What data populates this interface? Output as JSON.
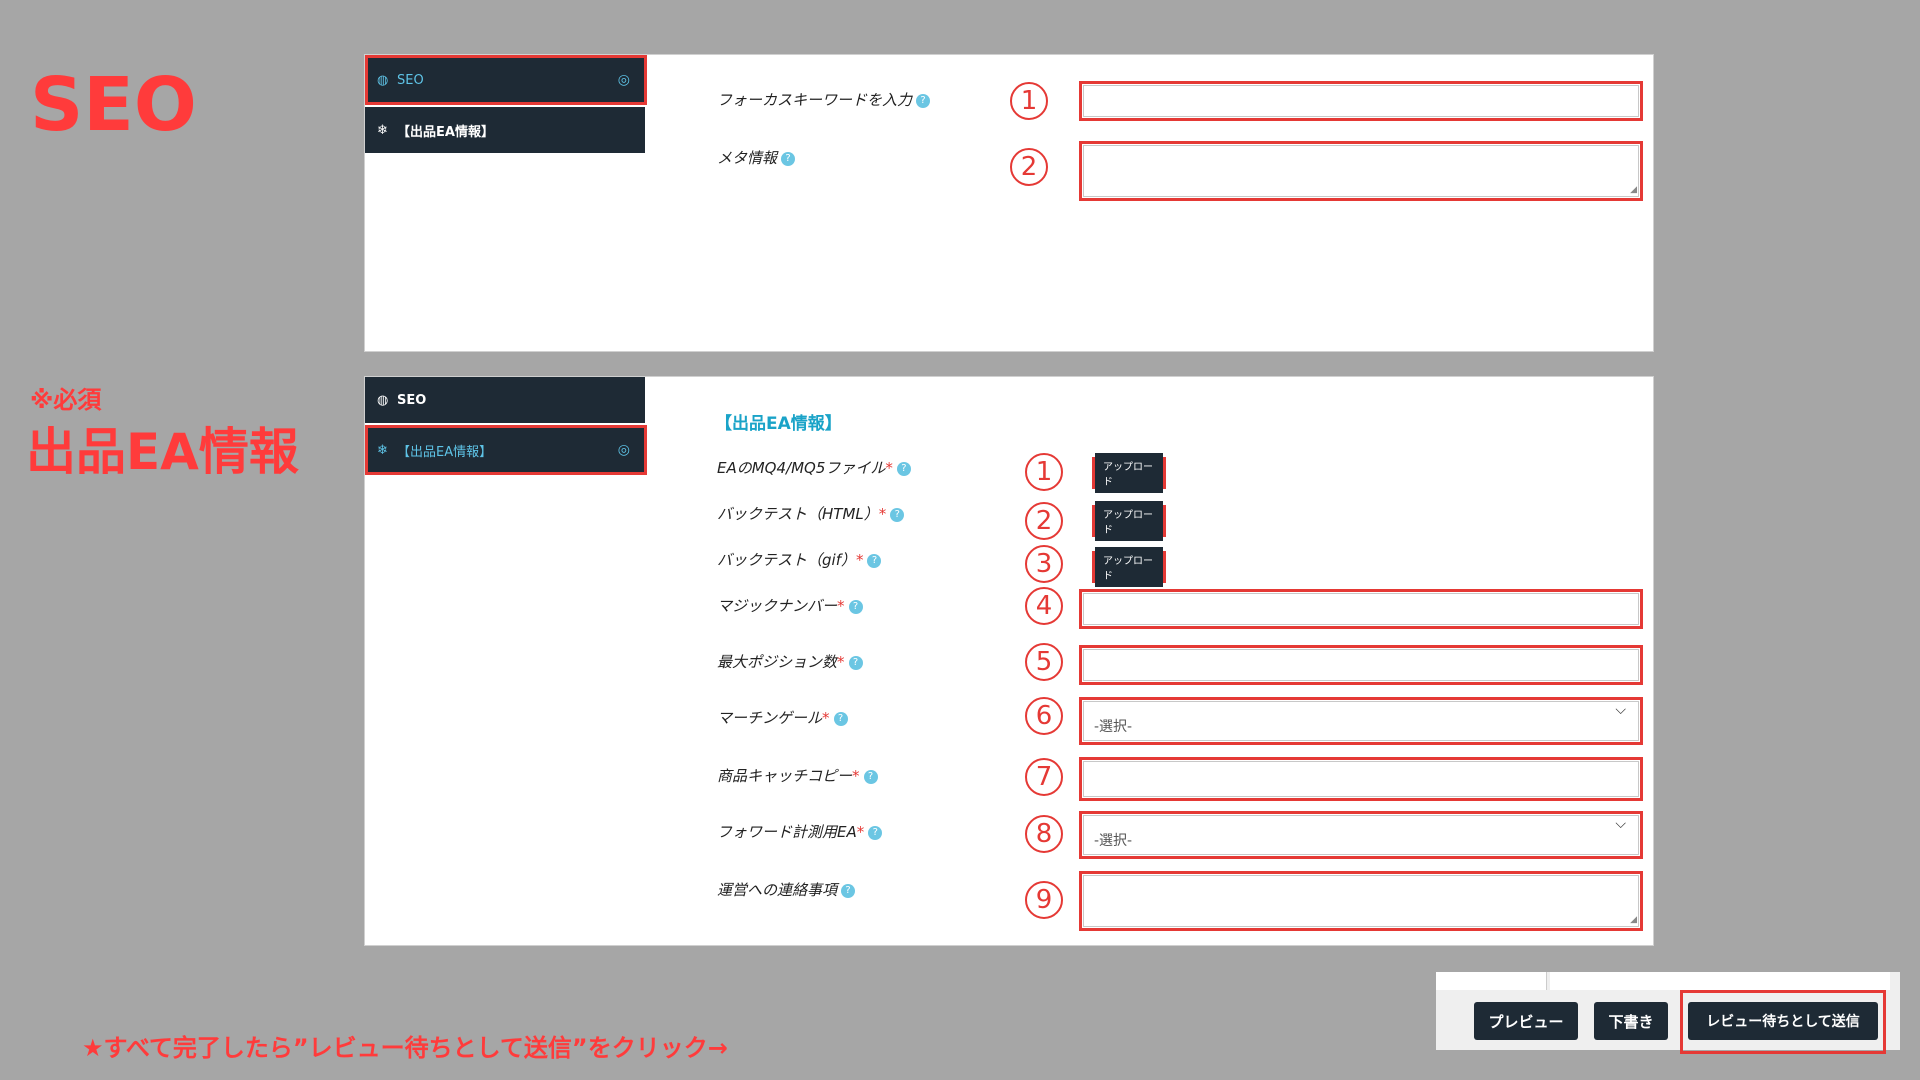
{
  "seo_section": {
    "title": "SEO",
    "sidebar": [
      {
        "label": "SEO",
        "icon": "globe-icon"
      },
      {
        "label": "【出品EA情報】",
        "icon": "snowflake-icon"
      }
    ],
    "fields": [
      {
        "label": "フォーカスキーワードを入力",
        "number": "1"
      },
      {
        "label": "メタ情報",
        "number": "2"
      }
    ]
  },
  "ea_section": {
    "note": "※必須",
    "title": "出品EA情報",
    "sidebar": [
      {
        "label": "SEO",
        "icon": "globe-icon"
      },
      {
        "label": "【出品EA情報】",
        "icon": "snowflake-icon"
      }
    ],
    "heading": "【出品EA情報】",
    "upload_label": "アップロード",
    "select_placeholder": "-選択-",
    "fields": [
      {
        "label": "EAのMQ4/MQ5ファイル",
        "number": "1",
        "required": "*"
      },
      {
        "label": "バックテスト（HTML）",
        "number": "2",
        "required": "*"
      },
      {
        "label": "バックテスト（gif）",
        "number": "3",
        "required": "*"
      },
      {
        "label": "マジックナンバー",
        "number": "4",
        "required": "*"
      },
      {
        "label": "最大ポジション数",
        "number": "5",
        "required": "*"
      },
      {
        "label": "マーチンゲール",
        "number": "6",
        "required": "*"
      },
      {
        "label": "商品キャッチコピー",
        "number": "7",
        "required": "*"
      },
      {
        "label": "フォワード計測用EA",
        "number": "8",
        "required": "*"
      },
      {
        "label": "運営への連絡事項",
        "number": "9"
      }
    ]
  },
  "footer": {
    "instruction": "★すべて完了したら”レビュー待ちとして送信”をクリック→",
    "buttons": {
      "preview": "プレビュー",
      "draft": "下書き",
      "submit": "レビュー待ちとして送信"
    }
  },
  "colors": {
    "accent_red": "#e53935",
    "sidebar_dark": "#1e2a35",
    "link_blue": "#1aa3c8"
  }
}
